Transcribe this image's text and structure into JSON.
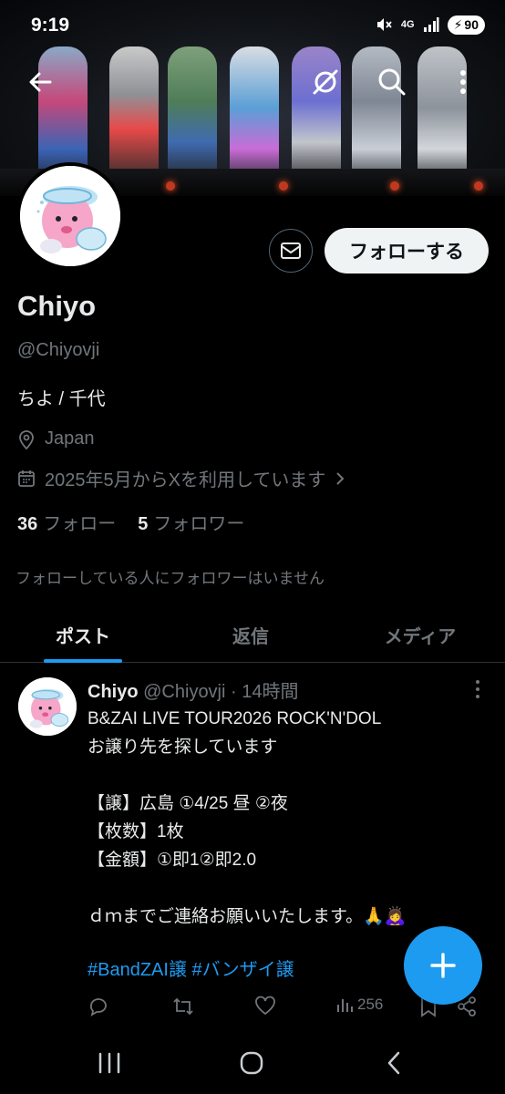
{
  "status_bar": {
    "time": "9:19",
    "network": "4G",
    "battery": "90"
  },
  "header": {
    "icons": [
      "back-arrow-icon",
      "grok-icon",
      "search-icon",
      "more-vertical-icon"
    ]
  },
  "profile": {
    "name": "Chiyo",
    "handle": "@Chiyovji",
    "bio": "ちよ / 千代",
    "location": "Japan",
    "joined": "2025年5月からXを利用しています",
    "following_count": "36",
    "following_label": "フォロー",
    "followers_count": "5",
    "followers_label": "フォロワー",
    "mutual_note": "フォローしている人にフォロワーはいません",
    "follow_button": "フォローする"
  },
  "tabs": [
    {
      "label": "ポスト",
      "active": true
    },
    {
      "label": "返信",
      "active": false
    },
    {
      "label": "メディア",
      "active": false
    }
  ],
  "post": {
    "author": "Chiyo",
    "handle": "@Chiyovji",
    "time": "· 14時間",
    "text": "B&ZAI LIVE TOUR2026 ROCK'N'DOL\nお譲り先を探しています\n\n【譲】広島 ①4/25 昼 ②夜\n【枚数】1枚\n【金額】①即1②即2.0\n\nｄｍまでご連絡お願いいたします。🙏🙇‍♀️",
    "hashtags": "#BandZAI譲 #バンザイ譲",
    "views": "256"
  },
  "colors": {
    "accent": "#1d9bf0",
    "background": "#000000",
    "text": "#e7e9ea",
    "muted": "#71767b"
  }
}
